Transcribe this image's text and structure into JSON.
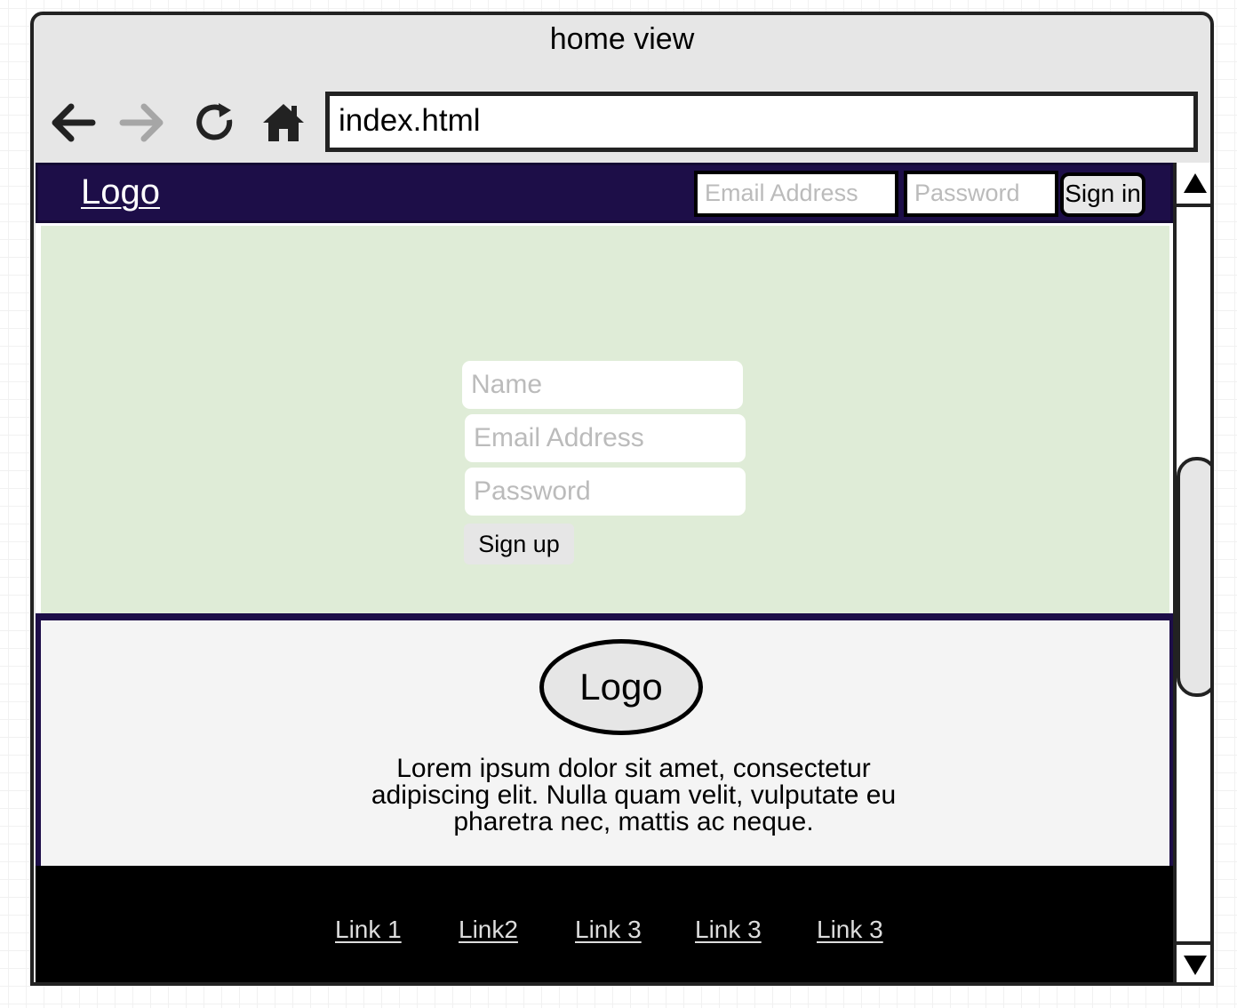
{
  "window": {
    "title": "home view"
  },
  "browser": {
    "url": "index.html",
    "back_icon": "arrow-left-icon",
    "forward_icon": "arrow-right-icon",
    "reload_icon": "reload-icon",
    "home_icon": "home-icon"
  },
  "header": {
    "logo": "Logo",
    "email_placeholder": "Email Address",
    "password_placeholder": "Password",
    "signin_label": "Sign in",
    "background": "#1d0e48"
  },
  "hero": {
    "name_placeholder": "Name",
    "email_placeholder": "Email Address",
    "password_placeholder": "Password",
    "signup_label": "Sign up",
    "background": "#dfecd7"
  },
  "about": {
    "logo": "Logo",
    "text": "Lorem ipsum dolor sit amet, consectetur adipiscing elit. Nulla quam velit, vulputate eu pharetra nec, mattis ac neque."
  },
  "footer": {
    "links": [
      "Link 1",
      "Link2",
      "Link 3",
      "Link 3",
      "Link 3"
    ],
    "background": "#000000"
  },
  "scrollbar": {
    "up_icon": "triangle-up-icon",
    "down_icon": "triangle-down-icon"
  }
}
